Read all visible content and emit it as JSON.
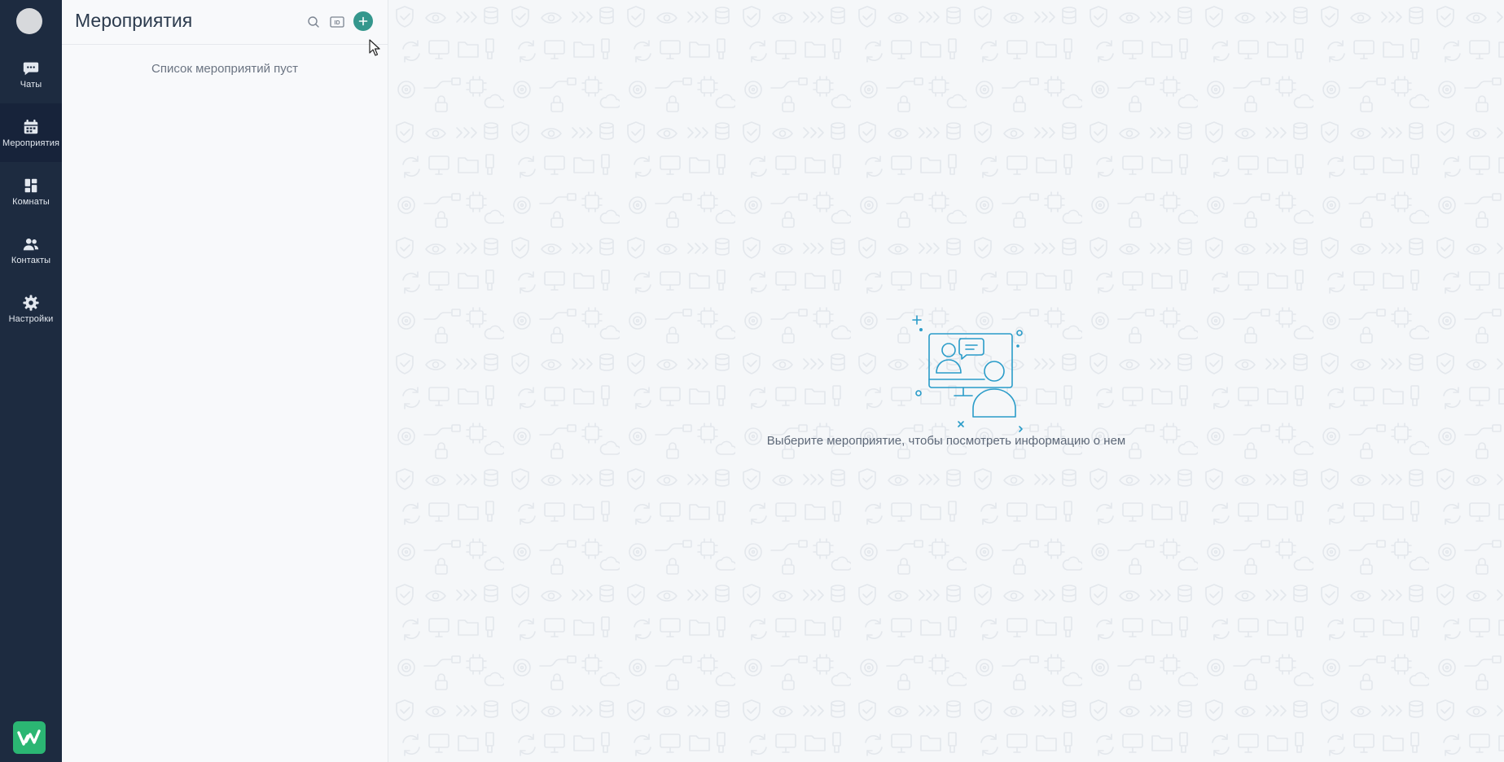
{
  "nav": {
    "items": [
      {
        "label": "Чаты",
        "icon": "chat-icon"
      },
      {
        "label": "Мероприятия",
        "icon": "calendar-icon"
      },
      {
        "label": "Комнаты",
        "icon": "rooms-icon"
      },
      {
        "label": "Контакты",
        "icon": "contacts-icon"
      },
      {
        "label": "Настройки",
        "icon": "gear-icon"
      }
    ],
    "active_index": 1
  },
  "panel": {
    "title": "Мероприятия",
    "empty_text": "Список мероприятий пуст"
  },
  "main": {
    "placeholder_text": "Выберите мероприятие, чтобы посмотреть информацию о нем"
  },
  "colors": {
    "rail_bg": "#1d2b40",
    "accent": "#35978d",
    "illustration": "#2a9cc9",
    "brand": "#2bb673"
  }
}
